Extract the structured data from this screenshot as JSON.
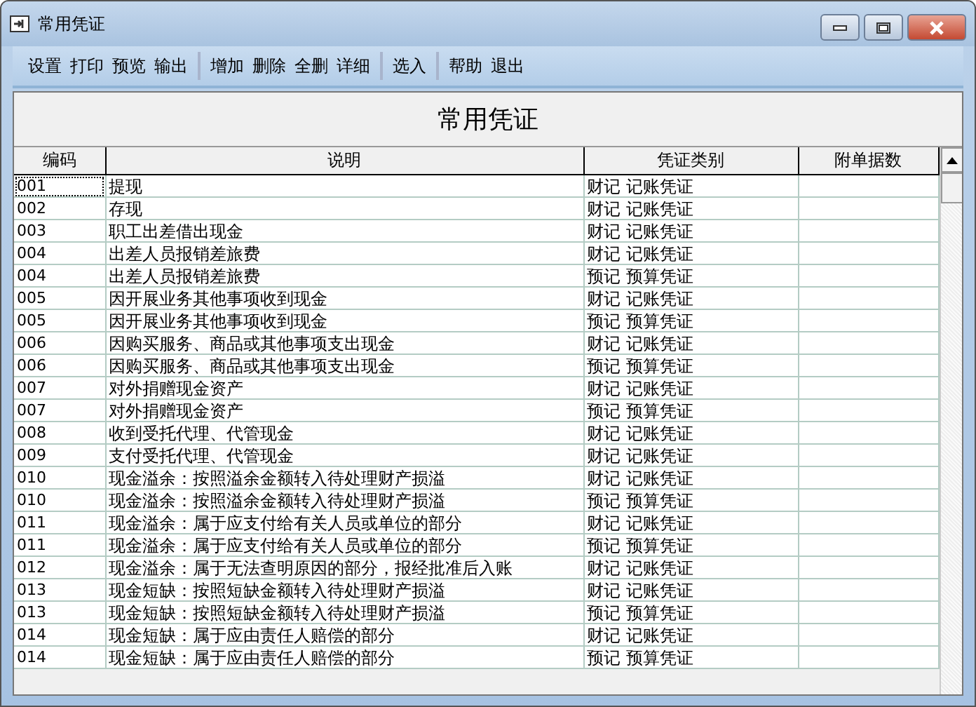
{
  "window": {
    "title": "常用凭证"
  },
  "toolbar": [
    [
      "设置",
      "打印",
      "预览",
      "输出"
    ],
    [
      "增加",
      "删除",
      "全删",
      "详细"
    ],
    [
      "选入"
    ],
    [
      "帮助",
      "退出"
    ]
  ],
  "heading": "常用凭证",
  "table": {
    "columns": [
      "编码",
      "说明",
      "凭证类别",
      "附单据数"
    ],
    "rows": [
      {
        "code": "001",
        "desc": "提现",
        "type": "财记 记账凭证",
        "selected": true
      },
      {
        "code": "002",
        "desc": "存现",
        "type": "财记 记账凭证",
        "selected": false
      },
      {
        "code": "003",
        "desc": "职工出差借出现金",
        "type": "财记 记账凭证",
        "selected": false
      },
      {
        "code": "004",
        "desc": "出差人员报销差旅费",
        "type": "财记 记账凭证",
        "selected": false
      },
      {
        "code": "004",
        "desc": "出差人员报销差旅费",
        "type": "预记 预算凭证",
        "selected": false
      },
      {
        "code": "005",
        "desc": "因开展业务其他事项收到现金",
        "type": "财记 记账凭证",
        "selected": false
      },
      {
        "code": "005",
        "desc": "因开展业务其他事项收到现金",
        "type": "预记 预算凭证",
        "selected": false
      },
      {
        "code": "006",
        "desc": "因购买服务、商品或其他事项支出现金",
        "type": "财记 记账凭证",
        "selected": false
      },
      {
        "code": "006",
        "desc": "因购买服务、商品或其他事项支出现金",
        "type": "预记 预算凭证",
        "selected": false
      },
      {
        "code": "007",
        "desc": "对外捐赠现金资产",
        "type": "财记 记账凭证",
        "selected": false
      },
      {
        "code": "007",
        "desc": "对外捐赠现金资产",
        "type": "预记 预算凭证",
        "selected": false
      },
      {
        "code": "008",
        "desc": "收到受托代理、代管现金",
        "type": "财记 记账凭证",
        "selected": false
      },
      {
        "code": "009",
        "desc": "支付受托代理、代管现金",
        "type": "财记 记账凭证",
        "selected": false
      },
      {
        "code": "010",
        "desc": "现金溢余：按照溢余金额转入待处理财产损溢",
        "type": "财记 记账凭证",
        "selected": false
      },
      {
        "code": "010",
        "desc": "现金溢余：按照溢余金额转入待处理财产损溢",
        "type": "预记 预算凭证",
        "selected": false
      },
      {
        "code": "011",
        "desc": "现金溢余：属于应支付给有关人员或单位的部分",
        "type": "财记 记账凭证",
        "selected": false
      },
      {
        "code": "011",
        "desc": "现金溢余：属于应支付给有关人员或单位的部分",
        "type": "预记 预算凭证",
        "selected": false
      },
      {
        "code": "012",
        "desc": "现金溢余：属于无法查明原因的部分，报经批准后入账",
        "type": "财记 记账凭证",
        "selected": false
      },
      {
        "code": "013",
        "desc": "现金短缺：按照短缺金额转入待处理财产损溢",
        "type": "财记 记账凭证",
        "selected": false
      },
      {
        "code": "013",
        "desc": "现金短缺：按照短缺金额转入待处理财产损溢",
        "type": "预记 预算凭证",
        "selected": false
      },
      {
        "code": "014",
        "desc": "现金短缺：属于应由责任人赔偿的部分",
        "type": "财记 记账凭证",
        "selected": false
      },
      {
        "code": "014",
        "desc": "现金短缺：属于应由责任人赔偿的部分",
        "type": "预记 预算凭证",
        "selected": false
      }
    ]
  }
}
